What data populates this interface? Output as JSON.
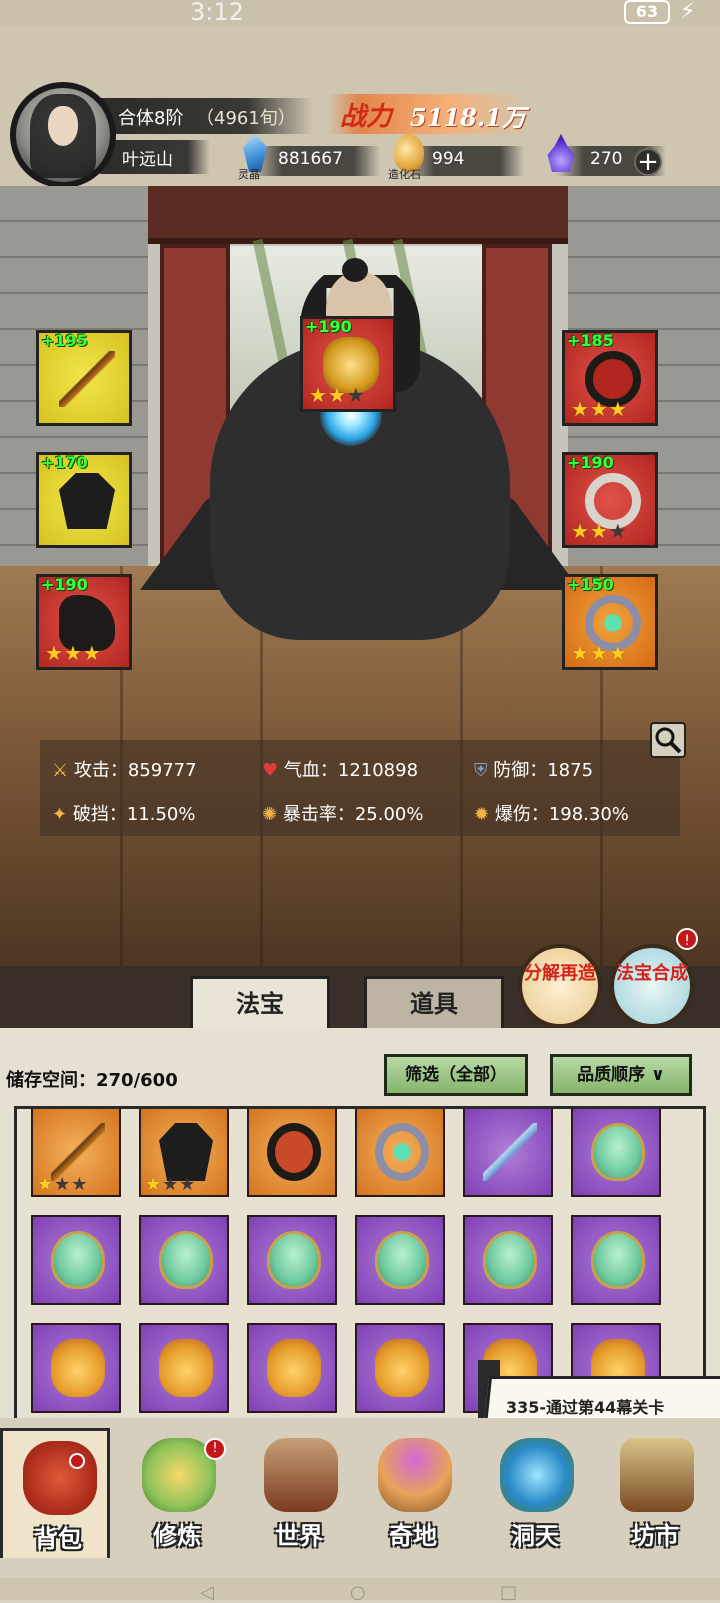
{
  "status_bar": {
    "time": "3:12",
    "battery": "63"
  },
  "player": {
    "realm": "合体8阶",
    "realm_detail": "（4961旬）",
    "name": "叶远山",
    "power_label": "战力",
    "power_value": "5118.1万"
  },
  "resources": [
    {
      "icon": "spirit-crystal-icon",
      "caption": "灵晶",
      "value": "881667"
    },
    {
      "icon": "creation-stone-icon",
      "caption": "造化石",
      "value": "994"
    },
    {
      "icon": "purple-flame-icon",
      "caption": "",
      "value": "270"
    }
  ],
  "equipment": [
    {
      "bonus": "+195",
      "color": "yellow",
      "item": "golden-staff",
      "stars": 0
    },
    {
      "bonus": "+190",
      "color": "red",
      "item": "golden-sigil",
      "stars": 2
    },
    {
      "bonus": "+185",
      "color": "red",
      "item": "red-headband",
      "stars": 3
    },
    {
      "bonus": "+170",
      "color": "yellow",
      "item": "black-robe",
      "stars": 0
    },
    {
      "bonus": "+190",
      "color": "red",
      "item": "jade-pendant",
      "stars": 2
    },
    {
      "bonus": "+190",
      "color": "red",
      "item": "black-boots",
      "stars": 3
    },
    {
      "bonus": "+150",
      "color": "orange",
      "item": "jade-ring",
      "stars": 3
    }
  ],
  "stats": [
    {
      "icon": "attack-icon",
      "label": "攻击：",
      "value": "859777"
    },
    {
      "icon": "health-icon",
      "label": "气血：",
      "value": "1210898"
    },
    {
      "icon": "defense-icon",
      "label": "防御：",
      "value": "1875"
    },
    {
      "icon": "armor-break-icon",
      "label": "破挡：",
      "value": "11.50%"
    },
    {
      "icon": "crit-rate-icon",
      "label": "暴击率：",
      "value": "25.00%"
    },
    {
      "icon": "crit-damage-icon",
      "label": "爆伤：",
      "value": "198.30%"
    }
  ],
  "actions": {
    "disassemble": "分解再造",
    "synthesize": "法宝合成",
    "badge": "!"
  },
  "tabs": [
    {
      "label": "法宝",
      "active": true
    },
    {
      "label": "道具",
      "active": false
    }
  ],
  "inventory": {
    "storage_label": "储存空间：",
    "storage_value": "270/600",
    "filter_label": "筛选（全部）",
    "sort_label": "品质顺序",
    "items": [
      {
        "color": "orange",
        "art": "staff",
        "stars": 1
      },
      {
        "color": "orange",
        "art": "robe",
        "stars": 1
      },
      {
        "color": "orange",
        "art": "headband",
        "stars": 0
      },
      {
        "color": "orange",
        "art": "ring",
        "stars": 0
      },
      {
        "color": "purple",
        "art": "sword",
        "stars": 0
      },
      {
        "color": "purple",
        "art": "fan",
        "stars": 0
      },
      {
        "color": "purple",
        "art": "fan",
        "stars": 0
      },
      {
        "color": "purple",
        "art": "fan",
        "stars": 0
      },
      {
        "color": "purple",
        "art": "fan",
        "stars": 0
      },
      {
        "color": "purple",
        "art": "fan",
        "stars": 0
      },
      {
        "color": "purple",
        "art": "fan",
        "stars": 0
      },
      {
        "color": "purple",
        "art": "fan",
        "stars": 0
      },
      {
        "color": "purple",
        "art": "lion",
        "stars": 0
      },
      {
        "color": "purple",
        "art": "lion",
        "stars": 0
      },
      {
        "color": "purple",
        "art": "lion",
        "stars": 0
      },
      {
        "color": "purple",
        "art": "lion",
        "stars": 0
      },
      {
        "color": "purple",
        "art": "lion",
        "stars": 0
      },
      {
        "color": "purple",
        "art": "lion",
        "stars": 0
      }
    ]
  },
  "quest_banner": "335-通过第44幕关卡",
  "bottom_nav": [
    {
      "label": "背包",
      "icon": "backpack-icon",
      "active": true,
      "badge": false
    },
    {
      "label": "修炼",
      "icon": "cultivate-icon",
      "active": false,
      "badge": true
    },
    {
      "label": "世界",
      "icon": "world-icon",
      "active": false,
      "badge": false
    },
    {
      "label": "奇地",
      "icon": "wonderland-icon",
      "active": false,
      "badge": false
    },
    {
      "label": "洞天",
      "icon": "cave-icon",
      "active": false,
      "badge": false
    },
    {
      "label": "坊市",
      "icon": "market-icon",
      "active": false,
      "badge": false
    }
  ]
}
